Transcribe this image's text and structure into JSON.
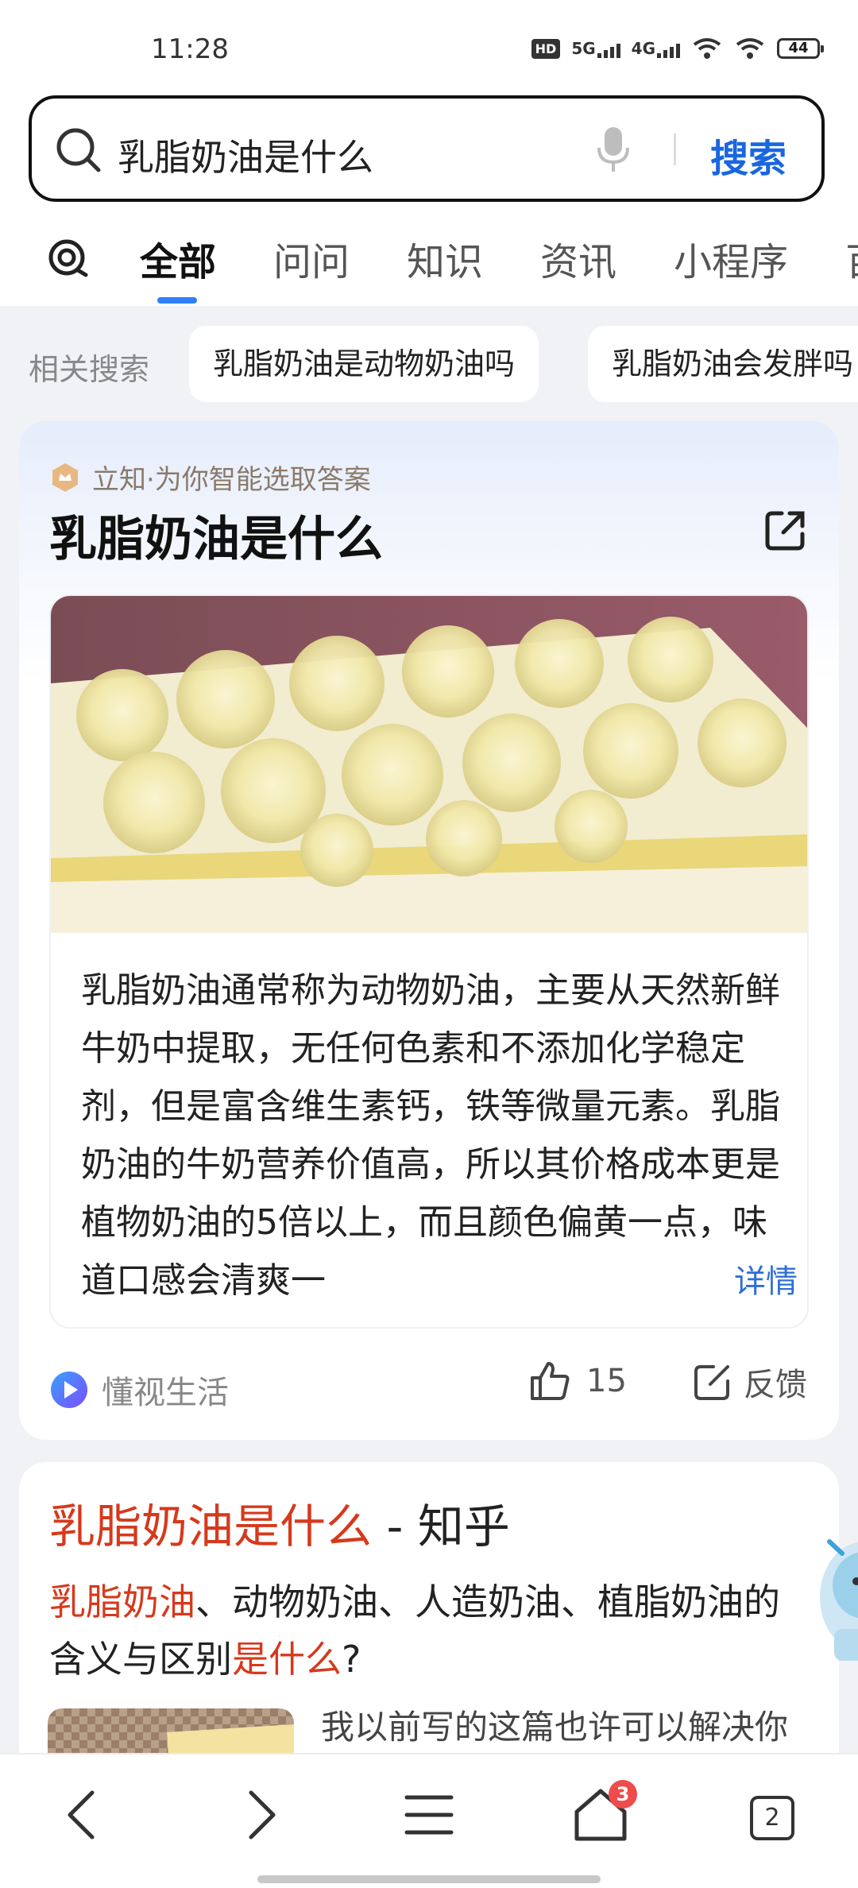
{
  "status_bar": {
    "time": "11:28",
    "hd_label": "HD",
    "signal_1_label": "5G",
    "signal_2_label": "4G",
    "battery": "44"
  },
  "search": {
    "query": "乳脂奶油是什么",
    "button_label": "搜索"
  },
  "tabs": [
    {
      "label": "全部",
      "active": true
    },
    {
      "label": "问问"
    },
    {
      "label": "知识"
    },
    {
      "label": "资讯"
    },
    {
      "label": "小程序"
    },
    {
      "label": "百"
    }
  ],
  "related": {
    "label": "相关搜索",
    "chips": [
      "乳脂奶油是动物奶油吗",
      "乳脂奶油会发胖吗"
    ]
  },
  "answer_card": {
    "source_text": "立知·为你智能选取答案",
    "title": "乳脂奶油是什么",
    "body": "乳脂奶油通常称为动物奶油，主要从天然新鲜牛奶中提取，无任何色素和不添加化学稳定剂，但是富含维生素钙，铁等微量元素。乳脂奶油的牛奶营养价值高，所以其价格成本更是植物奶油的5倍以上，而且颜色偏黄一点，味道口感会清爽一",
    "details_label": "详情",
    "provider_name": "懂视生活",
    "like_count": "15",
    "feedback_label": "反馈"
  },
  "result_card": {
    "title_highlight": "乳脂奶油是什么",
    "title_source": " - 知乎",
    "snippet_part1": "乳脂奶油",
    "snippet_part2": "、动物奶油、人造奶油、植脂奶油的含义与区别",
    "snippet_part3": "是什么",
    "snippet_part4": "?",
    "excerpt": "我以前写的这篇也许可以解决你"
  },
  "bottom_nav": {
    "badge_count": "3",
    "tabs_count": "2"
  },
  "colors": {
    "accent_blue": "#1a66e0",
    "highlight_red": "#d6391c",
    "tab_indicator": "#2f7ff5"
  }
}
